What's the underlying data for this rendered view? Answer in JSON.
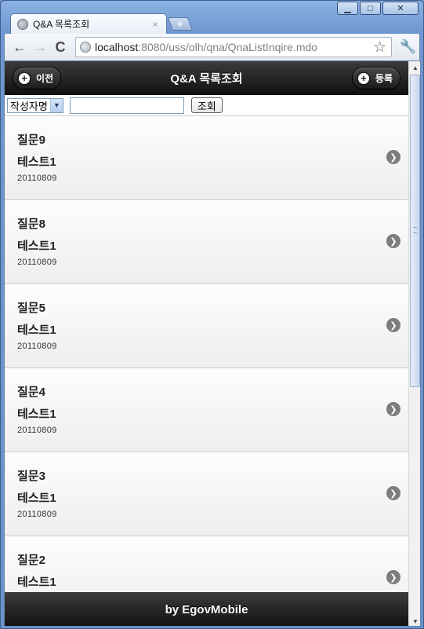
{
  "browser": {
    "window_controls": {
      "minimize": "▁",
      "maximize": "□",
      "close": "✕"
    },
    "tab": {
      "title": "Q&A 목록조회",
      "close": "×"
    },
    "new_tab": "+",
    "nav": {
      "back": "←",
      "forward": "→",
      "reload": "C"
    },
    "url": {
      "host": "localhost",
      "rest": ":8080/uss/olh/qna/QnaListInqire.mdo"
    },
    "star": "☆",
    "wrench": "🔧"
  },
  "header": {
    "title": "Q&A 목록조회",
    "back_button": "이전",
    "register_button": "등록",
    "plus_glyph": "+"
  },
  "search": {
    "select_value": "작성자명",
    "select_arrow": "▼",
    "input_value": "",
    "button_label": "조회"
  },
  "items": [
    {
      "title": "질문9",
      "content": "테스트1",
      "date": "20110809"
    },
    {
      "title": "질문8",
      "content": "테스트1",
      "date": "20110809"
    },
    {
      "title": "질문5",
      "content": "테스트1",
      "date": "20110809"
    },
    {
      "title": "질문4",
      "content": "테스트1",
      "date": "20110809"
    },
    {
      "title": "질문3",
      "content": "테스트1",
      "date": "20110809"
    },
    {
      "title": "질문2",
      "content": "테스트1",
      "date": ""
    }
  ],
  "chevron_glyph": "❯",
  "footer": {
    "text": "by EgovMobile"
  },
  "scrollbar": {
    "up": "▲",
    "down": "▼"
  }
}
